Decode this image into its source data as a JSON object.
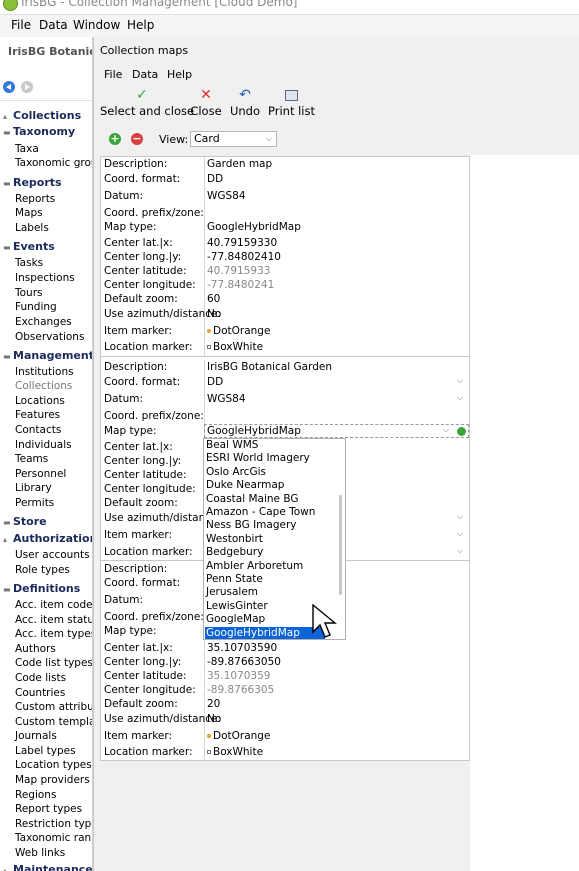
{
  "window": {
    "title": "IrisBG - Collection Management [Cloud Demo]"
  },
  "main_menu": [
    "File",
    "Data",
    "Window",
    "Help"
  ],
  "left_panel": {
    "title": "IrisBG Botanica",
    "sections": [
      {
        "label": "Collections",
        "items": []
      },
      {
        "label": "Taxonomy",
        "items": [
          "Taxa",
          "Taxonomic group"
        ]
      },
      {
        "label": "Reports",
        "items": [
          "Reports",
          "Maps",
          "Labels"
        ]
      },
      {
        "label": "Events",
        "items": [
          "Tasks",
          "Inspections",
          "Tours",
          "Funding",
          "Exchanges",
          "Observations"
        ]
      },
      {
        "label": "Management",
        "items": [
          "Institutions",
          "Collections",
          "Locations",
          "Features",
          "Contacts",
          "Individuals",
          "Teams",
          "Personnel",
          "Library",
          "Permits"
        ]
      },
      {
        "label": "Store",
        "items": []
      },
      {
        "label": "Authorization",
        "items": [
          "User accounts",
          "Role types"
        ]
      },
      {
        "label": "Definitions",
        "items": [
          "Acc. item codes",
          "Acc. item status",
          "Acc. item types",
          "Authors",
          "Code list types",
          "Code lists",
          "Countries",
          "Custom attribute",
          "Custom template",
          "Journals",
          "Label types",
          "Location types",
          "Map providers",
          "Regions",
          "Report types",
          "Restriction types",
          "Taxonomic ranks",
          "Web links"
        ]
      },
      {
        "label": "Maintenance",
        "items": []
      }
    ]
  },
  "dialog": {
    "title": "Collection maps",
    "menu": [
      "File",
      "Data",
      "Help"
    ],
    "toolbar": {
      "select_close": "Select and close",
      "close": "Close",
      "undo": "Undo",
      "print_list": "Print list"
    },
    "view_label": "View:",
    "view_value": "Card",
    "field_labels": {
      "description": "Description:",
      "coord_format": "Coord. format:",
      "datum": "Datum:",
      "coord_prefix": "Coord. prefix/zone:",
      "map_type": "Map type:",
      "center_lat_x": "Center lat.|x:",
      "center_long_y": "Center long.|y:",
      "center_latitude": "Center latitude:",
      "center_longitude": "Center longitude:",
      "default_zoom": "Default zoom:",
      "use_azimuth": "Use azimuth/distance:",
      "item_marker": "Item marker:",
      "location_marker": "Location marker:"
    },
    "cards": [
      {
        "description": "Garden map",
        "coord_format": "DD",
        "datum": "WGS84",
        "coord_prefix": "",
        "map_type": "GoogleHybridMap",
        "center_lat_x": "40.79159330",
        "center_long_y": "-77.84802410",
        "center_latitude": "40.7915933",
        "center_longitude": "-77.8480241",
        "default_zoom": "60",
        "use_azimuth": "No",
        "item_marker": "DotOrange",
        "location_marker": "BoxWhite"
      },
      {
        "description": "IrisBG Botanical Garden",
        "coord_format": "DD",
        "datum": "WGS84",
        "coord_prefix": "",
        "map_type": "GoogleHybridMap"
      },
      {
        "description": "",
        "coord_format": "",
        "datum": "",
        "coord_prefix": "",
        "map_type": "",
        "center_lat_x": "35.10703590",
        "center_long_y": "-89.87663050",
        "center_latitude": "35.1070359",
        "center_longitude": "-89.8766305",
        "default_zoom": "20",
        "use_azimuth": "No",
        "item_marker": "DotOrange",
        "location_marker": "BoxWhite"
      }
    ],
    "dropdown_options": [
      "Beal WMS",
      "ESRI World Imagery",
      "Oslo ArcGis",
      "Duke Nearmap",
      "Coastal Maine BG",
      "Amazon - Cape Town",
      "Ness BG Imagery",
      "Westonbirt",
      "Bedgebury",
      "Ambler Arboretum",
      "Penn State",
      "Jerusalem",
      "LewisGinter",
      "GoogleMap",
      "GoogleHybridMap"
    ],
    "dropdown_selected": "GoogleHybridMap",
    "colors": {
      "select_highlight": "#0a64d8",
      "add": "#3aa63a",
      "delete": "#d84040"
    }
  }
}
